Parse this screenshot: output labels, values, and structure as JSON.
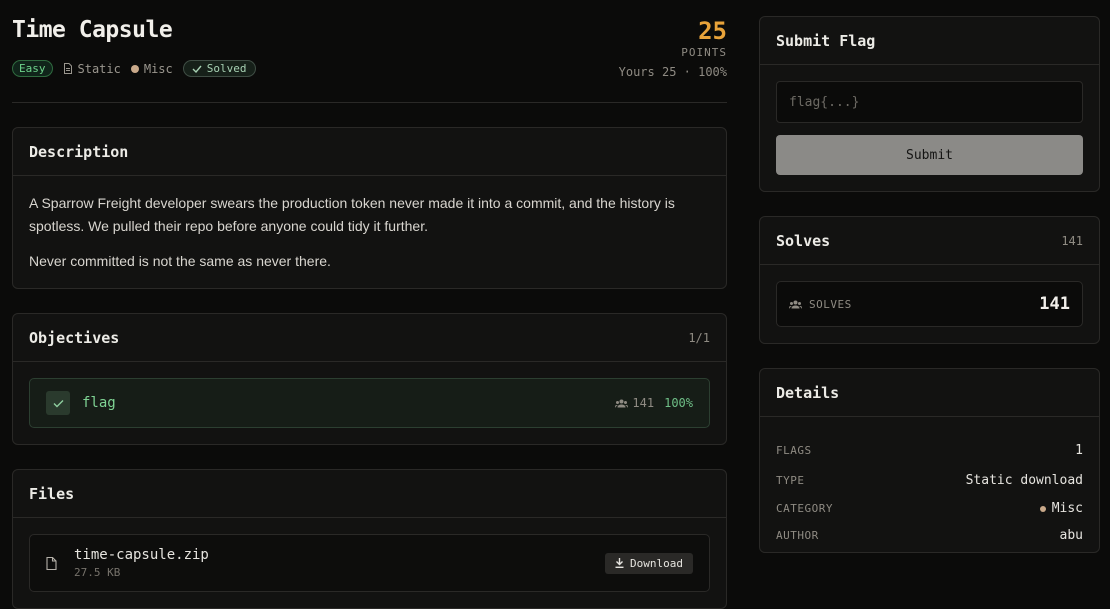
{
  "challenge": {
    "title": "Time Capsule",
    "difficulty": "Easy",
    "type": "Static",
    "category": "Misc",
    "status": "Solved",
    "points": "25",
    "points_label": "POINTS",
    "yours": "Yours 25 · 100%"
  },
  "description": {
    "heading": "Description",
    "paragraphs": [
      "A Sparrow Freight developer swears the production token never made it into a commit, and the history is spotless. We pulled their repo before anyone could tidy it further.",
      "Never committed is not the same as never there."
    ]
  },
  "objectives": {
    "heading": "Objectives",
    "count": "1/1",
    "items": [
      {
        "name": "flag",
        "solves": "141",
        "percent": "100%"
      }
    ]
  },
  "files": {
    "heading": "Files",
    "items": [
      {
        "name": "time-capsule.zip",
        "size": "27.5 KB",
        "action": "Download"
      }
    ]
  },
  "submit": {
    "heading": "Submit Flag",
    "placeholder": "flag{...}",
    "button": "Submit"
  },
  "solves": {
    "heading": "Solves",
    "count": "141",
    "label": "SOLVES",
    "value": "141"
  },
  "details": {
    "heading": "Details",
    "rows": [
      {
        "key": "FLAGS",
        "value": "1"
      },
      {
        "key": "TYPE",
        "value": "Static download"
      },
      {
        "key": "CATEGORY",
        "value": "Misc"
      },
      {
        "key": "AUTHOR",
        "value": "abu"
      }
    ]
  },
  "colors": {
    "accent_points": "#e8a33a",
    "success": "#6fd38c",
    "category_dot": "#c9a98a",
    "background": "#0b0b0a"
  },
  "icons": {
    "type": "file-icon",
    "solved": "check-icon",
    "solvers": "users-icon",
    "file": "document-icon",
    "download": "download-icon"
  }
}
